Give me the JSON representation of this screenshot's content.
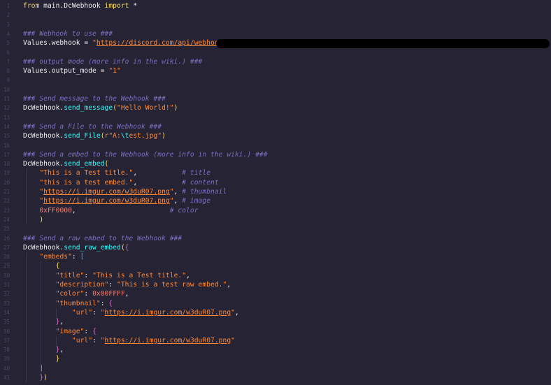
{
  "editor": {
    "line_numbers": [
      "1",
      "2",
      "3",
      "4",
      "5",
      "6",
      "7",
      "8",
      "9",
      "10",
      "11",
      "12",
      "13",
      "14",
      "15",
      "16",
      "17",
      "18",
      "19",
      "20",
      "21",
      "22",
      "23",
      "24",
      "25",
      "26",
      "27",
      "28",
      "29",
      "30",
      "31",
      "32",
      "33",
      "34",
      "35",
      "36",
      "37",
      "38",
      "39",
      "40",
      "41"
    ],
    "lines": [
      [
        [
          "kw",
          "from"
        ],
        [
          "plain",
          " main.DcWebhook "
        ],
        [
          "kw",
          "import"
        ],
        [
          "plain",
          " *"
        ]
      ],
      [],
      [],
      [
        [
          "cm",
          "### Webhook to use ###"
        ]
      ],
      [
        [
          "plain",
          "Values.webhook = "
        ],
        [
          "str",
          "\""
        ],
        [
          "url",
          "https://discord.com/api/webhooks/"
        ]
      ],
      [],
      [
        [
          "cm",
          "### output mode (more info in the wiki.) ###"
        ]
      ],
      [
        [
          "plain",
          "Values.output_mode = "
        ],
        [
          "str",
          "\"1\""
        ]
      ],
      [],
      [],
      [
        [
          "cm",
          "### Send message to the Webhook ###"
        ]
      ],
      [
        [
          "plain",
          "DcWebhook."
        ],
        [
          "fn",
          "send_message"
        ],
        [
          "brk1",
          "("
        ],
        [
          "str",
          "\"Hello World!\""
        ],
        [
          "brk1",
          ")"
        ]
      ],
      [],
      [
        [
          "cm",
          "### Send a File to the Webhook ###"
        ]
      ],
      [
        [
          "plain",
          "DcWebhook."
        ],
        [
          "fn",
          "send_File"
        ],
        [
          "brk1",
          "("
        ],
        [
          "str",
          "r\"A:"
        ],
        [
          "esc",
          "\\t"
        ],
        [
          "str",
          "est.jpg\""
        ],
        [
          "brk1",
          ")"
        ]
      ],
      [],
      [
        [
          "cm",
          "### Send a embed to the Webhook (more info in the wiki.) ###"
        ]
      ],
      [
        [
          "plain",
          "DcWebhook."
        ],
        [
          "fn",
          "send_embed"
        ],
        [
          "brk1",
          "("
        ]
      ],
      [
        [
          "plain",
          "    "
        ],
        [
          "str",
          "\"This is a Test title.\""
        ],
        [
          "plain",
          ",           "
        ],
        [
          "cm",
          "# title"
        ]
      ],
      [
        [
          "plain",
          "    "
        ],
        [
          "str",
          "\"this is a test embed.\""
        ],
        [
          "plain",
          ",           "
        ],
        [
          "cm",
          "# content"
        ]
      ],
      [
        [
          "plain",
          "    "
        ],
        [
          "str",
          "\""
        ],
        [
          "url",
          "https://i.imgur.com/w3duR07.png"
        ],
        [
          "str",
          "\""
        ],
        [
          "plain",
          ", "
        ],
        [
          "cm",
          "# thumbnail"
        ]
      ],
      [
        [
          "plain",
          "    "
        ],
        [
          "str",
          "\""
        ],
        [
          "url",
          "https://i.imgur.com/w3duR07.png"
        ],
        [
          "str",
          "\""
        ],
        [
          "plain",
          ", "
        ],
        [
          "cm",
          "# image"
        ]
      ],
      [
        [
          "plain",
          "    "
        ],
        [
          "num",
          "0xFF0000"
        ],
        [
          "plain",
          ",                       "
        ],
        [
          "cm",
          "# color"
        ]
      ],
      [
        [
          "plain",
          "    "
        ],
        [
          "brk1",
          ")"
        ]
      ],
      [],
      [
        [
          "cm",
          "### Send a raw embed to the Webhook ###"
        ]
      ],
      [
        [
          "plain",
          "DcWebhook."
        ],
        [
          "fn",
          "send_raw_embed"
        ],
        [
          "brk1",
          "("
        ],
        [
          "brk2",
          "{"
        ]
      ],
      [
        [
          "plain",
          "    "
        ],
        [
          "key",
          "\"embeds\""
        ],
        [
          "plain",
          ": "
        ],
        [
          "brk3",
          "["
        ]
      ],
      [
        [
          "plain",
          "        "
        ],
        [
          "brk1",
          "{"
        ]
      ],
      [
        [
          "plain",
          "        "
        ],
        [
          "key",
          "\"title\""
        ],
        [
          "plain",
          ": "
        ],
        [
          "str",
          "\"This is a Test title.\""
        ],
        [
          "plain",
          ","
        ]
      ],
      [
        [
          "plain",
          "        "
        ],
        [
          "key",
          "\"description\""
        ],
        [
          "plain",
          ": "
        ],
        [
          "str",
          "\"This is a test raw embed.\""
        ],
        [
          "plain",
          ","
        ]
      ],
      [
        [
          "plain",
          "        "
        ],
        [
          "key",
          "\"color\""
        ],
        [
          "plain",
          ": "
        ],
        [
          "num",
          "0x00FFFF"
        ],
        [
          "plain",
          ","
        ]
      ],
      [
        [
          "plain",
          "        "
        ],
        [
          "key",
          "\"thumbnail\""
        ],
        [
          "plain",
          ": "
        ],
        [
          "brk2",
          "{"
        ]
      ],
      [
        [
          "plain",
          "            "
        ],
        [
          "key",
          "\"url\""
        ],
        [
          "plain",
          ": "
        ],
        [
          "str",
          "\""
        ],
        [
          "url",
          "https://i.imgur.com/w3duR07.png"
        ],
        [
          "str",
          "\""
        ],
        [
          "plain",
          ","
        ]
      ],
      [
        [
          "plain",
          "        "
        ],
        [
          "brk2",
          "}"
        ],
        [
          "plain",
          ","
        ]
      ],
      [
        [
          "plain",
          "        "
        ],
        [
          "key",
          "\"image\""
        ],
        [
          "plain",
          ": "
        ],
        [
          "brk2",
          "{"
        ]
      ],
      [
        [
          "plain",
          "            "
        ],
        [
          "key",
          "\"url\""
        ],
        [
          "plain",
          ": "
        ],
        [
          "str",
          "\""
        ],
        [
          "url",
          "https://i.imgur.com/w3duR07.png"
        ],
        [
          "str",
          "\""
        ]
      ],
      [
        [
          "plain",
          "        "
        ],
        [
          "brk2",
          "}"
        ],
        [
          "plain",
          ","
        ]
      ],
      [
        [
          "plain",
          "        "
        ],
        [
          "brk1",
          "}"
        ]
      ],
      [
        [
          "plain",
          "    "
        ],
        [
          "brk3",
          "]"
        ]
      ],
      [
        [
          "plain",
          "    "
        ],
        [
          "brk2",
          "}"
        ],
        [
          "brk1",
          ")"
        ]
      ]
    ]
  }
}
